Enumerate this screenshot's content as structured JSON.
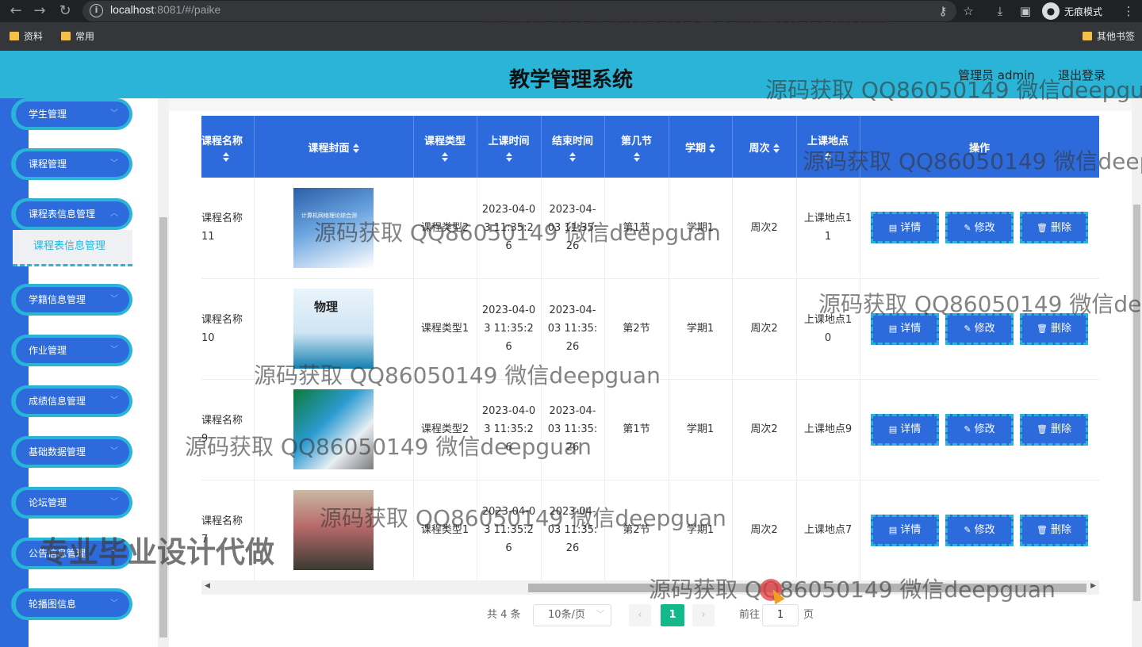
{
  "browser": {
    "url_host": "localhost",
    "url_rest": ":8081/#/paike",
    "incognito_label": "无痕模式",
    "bookmarks": [
      "资料",
      "常用"
    ],
    "other_bookmarks": "其他书签"
  },
  "header": {
    "title": "教学管理系统",
    "admin_label": "管理员 admin",
    "logout_label": "退出登录"
  },
  "sidebar": {
    "menus": [
      "学生管理",
      "课程管理",
      "课程表信息管理",
      "学籍信息管理",
      "作业管理",
      "成绩信息管理",
      "基础数据管理",
      "论坛管理",
      "公告信息管理",
      "轮播图信息"
    ],
    "active_submenu": "课程表信息管理"
  },
  "table": {
    "columns": [
      "课程名称",
      "课程封面",
      "课程类型",
      "上课时间",
      "结束时间",
      "第几节",
      "学期",
      "周次",
      "上课地点",
      "操作"
    ],
    "rows": [
      {
        "name": "课程名称11",
        "cover_caption": "计算机网络理论综合测",
        "type": "课程类型2",
        "start": "2023-04-03 11:35:26",
        "end": "2023-04-03 11:35:26",
        "section": "第1节",
        "term": "学期1",
        "week": "周次2",
        "place": "上课地点11"
      },
      {
        "name": "课程名称10",
        "cover_caption": "物理",
        "type": "课程类型1",
        "start": "2023-04-03 11:35:26",
        "end": "2023-04-03 11:35:26",
        "section": "第2节",
        "term": "学期1",
        "week": "周次2",
        "place": "上课地点10"
      },
      {
        "name": "课程名称9",
        "cover_caption": "",
        "type": "课程类型2",
        "start": "2023-04-03 11:35:26",
        "end": "2023-04-03 11:35:26",
        "section": "第1节",
        "term": "学期1",
        "week": "周次2",
        "place": "上课地点9"
      },
      {
        "name": "课程名称7",
        "cover_caption": "",
        "type": "课程类型1",
        "start": "2023-04-03 11:35:26",
        "end": "2023-04-03 11:35:26",
        "section": "第2节",
        "term": "学期1",
        "week": "周次2",
        "place": "上课地点7"
      }
    ],
    "actions": {
      "detail": "详情",
      "edit": "修改",
      "delete": "删除"
    }
  },
  "pagination": {
    "total": "共 4 条",
    "page_size": "10条/页",
    "current_page": "1",
    "goto_label": "前往",
    "goto_value": "1",
    "page_unit": "页"
  },
  "watermarks": {
    "text": "源码获取 QQ86050149 微信deepguan",
    "big": "专业毕业设计代做"
  },
  "colors": {
    "header_bg": "#2ab5d8",
    "primary_blue": "#2d6bdc",
    "pager_active": "#13b98a"
  }
}
